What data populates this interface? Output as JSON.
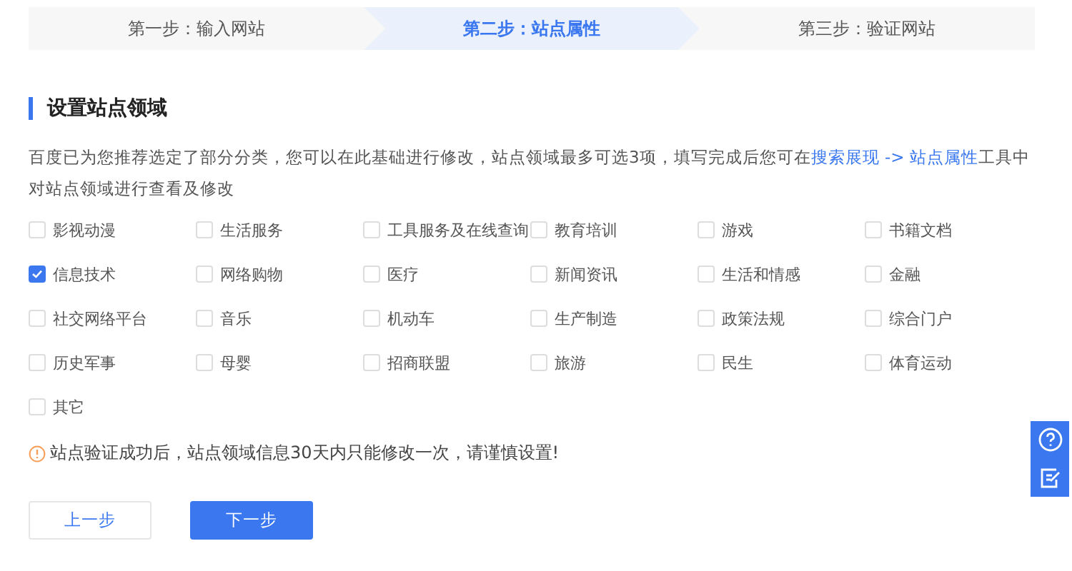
{
  "steps": [
    {
      "label": "第一步：输入网站",
      "selected": false
    },
    {
      "label": "第二步：站点属性",
      "selected": true
    },
    {
      "label": "第三步：验证网站",
      "selected": false
    }
  ],
  "section_title": "设置站点领域",
  "description": {
    "before": "百度已为您推荐选定了部分分类，您可以在此基础进行修改，站点领域最多可选3项，填写完成后您可在",
    "link": "搜索展现 -> 站点属性",
    "after": "工具中对站点领域进行查看及修改"
  },
  "categories": [
    {
      "label": "影视动漫",
      "checked": false
    },
    {
      "label": "生活服务",
      "checked": false
    },
    {
      "label": "工具服务及在线查询",
      "checked": false
    },
    {
      "label": "教育培训",
      "checked": false
    },
    {
      "label": "游戏",
      "checked": false
    },
    {
      "label": "书籍文档",
      "checked": false
    },
    {
      "label": "信息技术",
      "checked": true
    },
    {
      "label": "网络购物",
      "checked": false
    },
    {
      "label": "医疗",
      "checked": false
    },
    {
      "label": "新闻资讯",
      "checked": false
    },
    {
      "label": "生活和情感",
      "checked": false
    },
    {
      "label": "金融",
      "checked": false
    },
    {
      "label": "社交网络平台",
      "checked": false
    },
    {
      "label": "音乐",
      "checked": false
    },
    {
      "label": "机动车",
      "checked": false
    },
    {
      "label": "生产制造",
      "checked": false
    },
    {
      "label": "政策法规",
      "checked": false
    },
    {
      "label": "综合门户",
      "checked": false
    },
    {
      "label": "历史军事",
      "checked": false
    },
    {
      "label": "母婴",
      "checked": false
    },
    {
      "label": "招商联盟",
      "checked": false
    },
    {
      "label": "旅游",
      "checked": false
    },
    {
      "label": "民生",
      "checked": false
    },
    {
      "label": "体育运动",
      "checked": false
    },
    {
      "label": "其它",
      "checked": false
    }
  ],
  "warning": "站点验证成功后，站点领域信息30天内只能修改一次，请谨慎设置!",
  "buttons": [
    {
      "label": "上一步",
      "kind": "secondary"
    },
    {
      "label": "下一步",
      "kind": "primary"
    }
  ]
}
